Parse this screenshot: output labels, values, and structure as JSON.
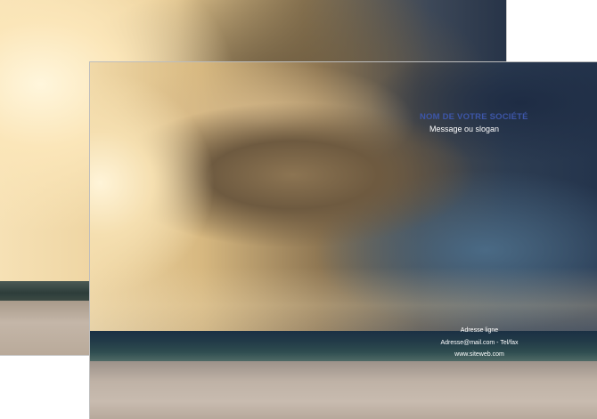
{
  "back_sheet": {
    "image": "storm-over-beach-photo"
  },
  "front_sheet": {
    "image": "storm-over-beach-photo",
    "company_name": "NOM DE VOTRE SOCIÉTÉ",
    "slogan": "Message ou slogan",
    "address_line": "Adresse ligne",
    "contact_line": "Adresse@mail.com - Tel/fax",
    "website": "www.siteweb.com"
  },
  "colors": {
    "company_name": "#3d56a8",
    "text": "#ffffff"
  }
}
